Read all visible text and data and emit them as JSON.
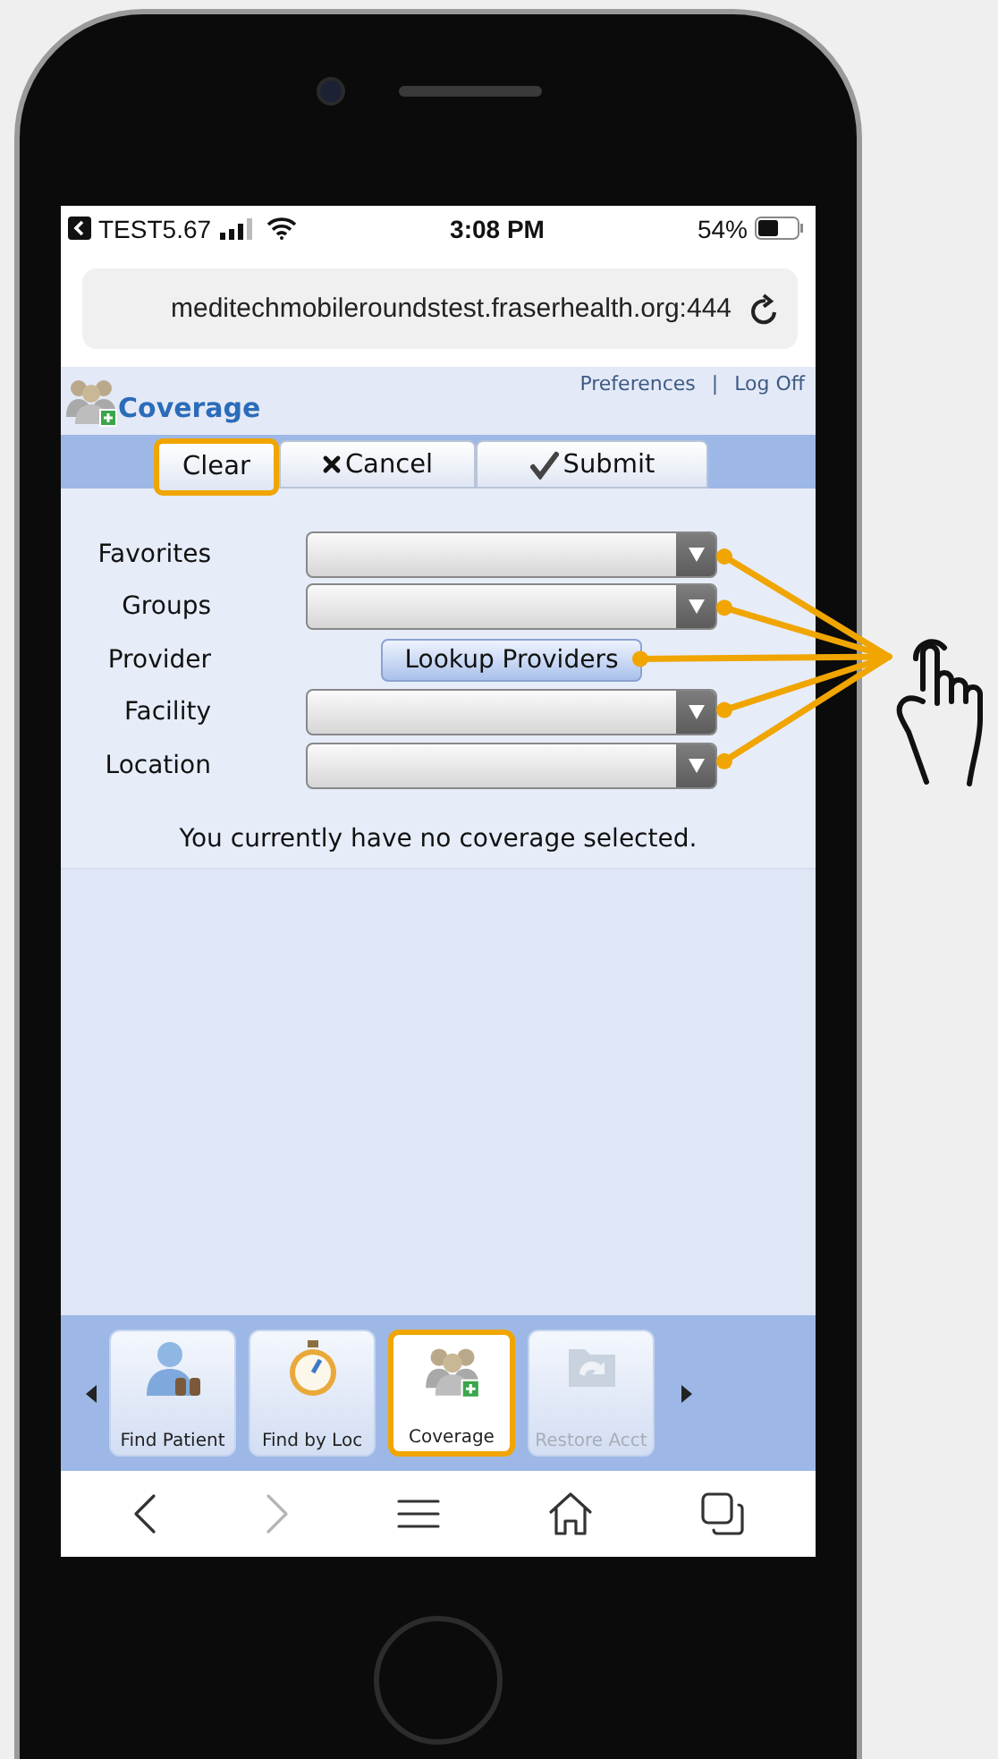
{
  "status_bar": {
    "back_label": "TEST5.67",
    "time": "3:08 PM",
    "battery": "54%"
  },
  "address_bar": {
    "url": "meditechmobileroundstest.fraserhealth.org:444"
  },
  "header": {
    "title": "Coverage",
    "links": [
      "Preferences",
      "Log Off"
    ],
    "separator": "|"
  },
  "toolbar": {
    "buttons": [
      {
        "label": "Clear",
        "kind": "plain",
        "highlighted": true
      },
      {
        "label": "Cancel",
        "kind": "cancel",
        "highlighted": false
      },
      {
        "label": "Submit",
        "kind": "submit",
        "highlighted": false
      }
    ]
  },
  "form": {
    "fields": [
      {
        "label": "Favorites",
        "kind": "select",
        "callout": true
      },
      {
        "label": "Groups",
        "kind": "select",
        "callout": true
      },
      {
        "label": "Provider",
        "kind": "button",
        "button_label": "Lookup Providers",
        "callout": true
      },
      {
        "label": "Facility",
        "kind": "select",
        "callout": true
      },
      {
        "label": "Location",
        "kind": "select",
        "callout": true
      }
    ]
  },
  "message": "You currently have no coverage selected.",
  "nav": {
    "tiles": [
      {
        "label": "Find Patient",
        "kind": "patient",
        "selected": false,
        "disabled": false,
        "highlighted": false
      },
      {
        "label": "Find by Loc",
        "kind": "stopwatch",
        "selected": false,
        "disabled": false,
        "highlighted": false
      },
      {
        "label": "Coverage",
        "kind": "coverage",
        "selected": true,
        "disabled": false,
        "highlighted": true
      },
      {
        "label": "Restore Acct",
        "kind": "restore",
        "selected": false,
        "disabled": true,
        "highlighted": false
      }
    ]
  },
  "browser_toolbar": {
    "items": [
      {
        "kind": "back",
        "disabled": false
      },
      {
        "kind": "forward",
        "disabled": true
      },
      {
        "kind": "menu",
        "disabled": false
      },
      {
        "kind": "home",
        "disabled": false
      },
      {
        "kind": "tabs",
        "disabled": false
      }
    ]
  }
}
